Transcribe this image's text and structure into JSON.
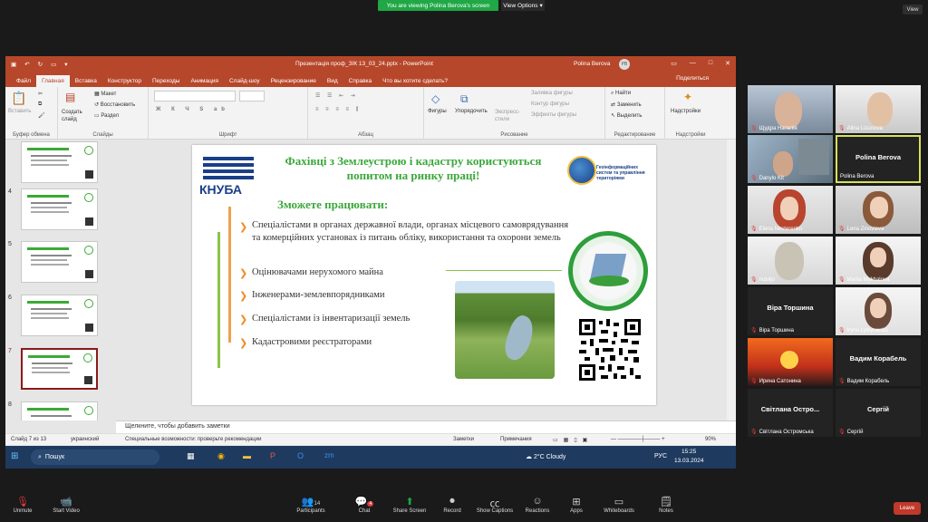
{
  "zoom_top": {
    "banner": "You are viewing Polina Berova's screen",
    "view_options": "View Options",
    "view": "View"
  },
  "ppt": {
    "title": "Презентація проф_ЗІК 13_03_24.pptx  -  PowerPoint",
    "user": "Polina Berova",
    "user_initials": "PB",
    "tabs": [
      "Файл",
      "Главная",
      "Вставка",
      "Конструктор",
      "Переходы",
      "Анимация",
      "Слайд-шоу",
      "Рецензирование",
      "Вид",
      "Справка",
      "Что вы хотите сделать?"
    ],
    "share": "Поделиться",
    "ribbon": {
      "paste": "Вставить",
      "clipboard": "Буфер обмена",
      "new_slide": "Создать слайд",
      "layout": "Макет",
      "reset": "Восстановить",
      "section": "Раздел",
      "slides": "Слайды",
      "font": "Шрифт",
      "paragraph": "Абзац",
      "shapes": "Фигуры",
      "arrange": "Упорядочить",
      "quick_styles": "Экспресс-стили",
      "fill": "Заливка фигуры",
      "outline": "Контур фигуры",
      "effects": "Эффекты фигуры",
      "drawing": "Рисование",
      "find": "Найти",
      "replace": "Заменить",
      "select": "Выделить",
      "editing": "Редактирование",
      "addins": "Надстройки",
      "addins_group": "Надстройки"
    },
    "slide_numbers": [
      "4",
      "5",
      "6",
      "7",
      "8"
    ],
    "notes_placeholder": "Щелкните, чтобы добавить заметки",
    "status": {
      "slide": "Слайд 7 из 13",
      "lang": "украинский",
      "access": "Специальные возможности: проверьте рекомендации",
      "notes": "Заметки",
      "comments": "Примечания",
      "zoom": "90%"
    }
  },
  "slide": {
    "logo": "КНУБА",
    "title": "Фахівці з Землеустрою і кадастру користуються попитом на ринку праці!",
    "subtitle": "Зможете працювати:",
    "bullets": [
      "Спеціалістами в органах державної влади, органах місцевого самоврядування та комерційних установах із питань обліку, використання та охорони земель",
      "Оцінювачами нерухомого майна",
      "Інженерами-землевпорядниками",
      "Спеціалістами із інвентаризації земель",
      "Кадастровими реєстраторами"
    ],
    "dept_logo": "Геоінформаційних систем та управління територіями"
  },
  "taskbar": {
    "search": "Пошук",
    "weather": "2°C  Cloudy",
    "lang": "РУС",
    "time": "15:25",
    "date": "13.03.2024"
  },
  "participants": [
    {
      "name": "Щудра Наталія",
      "video": true
    },
    {
      "name": "Alina Lizunova",
      "video": true
    },
    {
      "name": "Danylo Kit",
      "video": true
    },
    {
      "name": "Polina Berova",
      "video": false,
      "big": "Polina Berova"
    },
    {
      "name": "Elena Nesterenko",
      "video": true
    },
    {
      "name": "Lena Zinovieva",
      "video": true
    },
    {
      "name": "nubiljo",
      "video": true
    },
    {
      "name": "Mariia Mykhalova",
      "video": true
    },
    {
      "name": "Віра Торшина",
      "video": false,
      "big": "Віра Торшина"
    },
    {
      "name": "Iryna Lytvynenko",
      "video": true
    },
    {
      "name": "Ирина Сатонина",
      "video": true
    },
    {
      "name": "Вадим Корабель",
      "video": false,
      "big": "Вадим Корабель"
    },
    {
      "name": "Світлана Остромська",
      "video": false,
      "big": "Світлана  Остро..."
    },
    {
      "name": "Сергій",
      "video": false,
      "big": "Сергій"
    }
  ],
  "zoom_bar": {
    "unmute": "Unmute",
    "start_video": "Start Video",
    "participants": "Participants",
    "participants_count": "14",
    "chat": "Chat",
    "chat_badge": "4",
    "share": "Share Screen",
    "record": "Record",
    "captions": "Show Captions",
    "reactions": "Reactions",
    "apps": "Apps",
    "whiteboards": "Whiteboards",
    "notes": "Notes",
    "leave": "Leave"
  },
  "colors": {
    "ppt_red": "#b7472a",
    "green": "#3aa83a",
    "blue": "#1a3f8a",
    "zoom_green": "#1fa845"
  }
}
